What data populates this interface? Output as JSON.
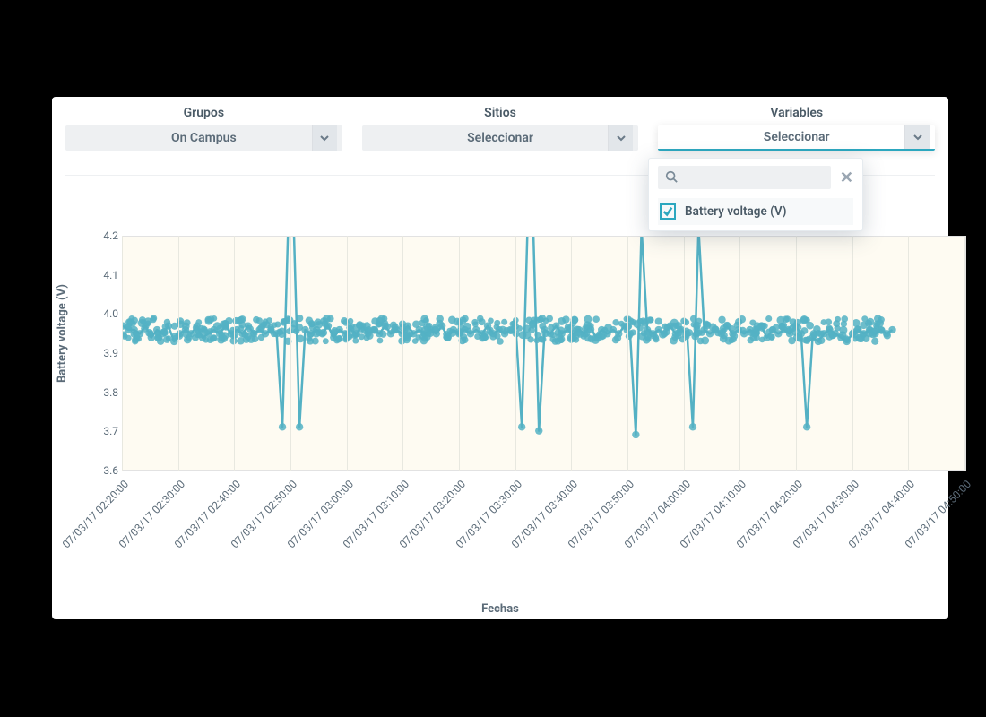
{
  "filters": {
    "grupos": {
      "label": "Grupos",
      "value": "On Campus"
    },
    "sitios": {
      "label": "Sitios",
      "value": "Seleccionar"
    },
    "variables": {
      "label": "Variables",
      "value": "Seleccionar"
    }
  },
  "variables_dropdown": {
    "search_placeholder": "",
    "close_title": "Cerrar",
    "items": [
      {
        "label": "Battery voltage (V)",
        "checked": true
      }
    ]
  },
  "colors": {
    "accent": "#2ca7bf",
    "series": "#54b1c4",
    "plot_bg": "#fefbf2"
  },
  "chart_data": {
    "type": "scatter",
    "title": "",
    "xlabel": "Fechas",
    "ylabel": "Battery voltage (V)",
    "ylim": [
      3.6,
      4.2
    ],
    "yticks": [
      3.6,
      3.7,
      3.8,
      3.9,
      4.0,
      4.1,
      4.2
    ],
    "x_tick_labels": [
      "07/03/17 02:20:00",
      "07/03/17 02:30:00",
      "07/03/17 02:40:00",
      "07/03/17 02:50:00",
      "07/03/17 03:00:00",
      "07/03/17 03:10:00",
      "07/03/17 03:20:00",
      "07/03/17 03:30:00",
      "07/03/17 03:40:00",
      "07/03/17 03:50:00",
      "07/03/17 04:00:00",
      "07/03/17 04:10:00",
      "07/03/17 04:20:00",
      "07/03/17 04:30:00",
      "07/03/17 04:40:00",
      "07/03/17 04:50:00"
    ],
    "series": [
      {
        "name": "Battery voltage (V)",
        "description": "Dense scatter, ~3.92–3.98 V baseline with several spikes above 4.2 V and dips to ~3.70 V. Approximate values sampled across the visible time range.",
        "x": [
          "07/03/17 02:20:00",
          "07/03/17 02:21:00",
          "07/03/17 02:22:00",
          "07/03/17 02:23:00",
          "07/03/17 02:24:00",
          "07/03/17 02:25:00",
          "07/03/17 02:26:00",
          "07/03/17 02:27:00",
          "07/03/17 02:28:00",
          "07/03/17 02:29:00",
          "07/03/17 02:30:00",
          "07/03/17 02:31:00",
          "07/03/17 02:32:00",
          "07/03/17 02:33:00",
          "07/03/17 02:34:00",
          "07/03/17 02:35:00",
          "07/03/17 02:36:00",
          "07/03/17 02:37:00",
          "07/03/17 02:38:00",
          "07/03/17 02:39:00",
          "07/03/17 02:40:00",
          "07/03/17 02:41:00",
          "07/03/17 02:42:00",
          "07/03/17 02:43:00",
          "07/03/17 02:44:00",
          "07/03/17 02:45:00",
          "07/03/17 02:46:00",
          "07/03/17 02:47:00",
          "07/03/17 02:48:00",
          "07/03/17 02:49:00",
          "07/03/17 02:50:00",
          "07/03/17 02:51:00",
          "07/03/17 02:52:00",
          "07/03/17 02:53:00",
          "07/03/17 02:54:00",
          "07/03/17 02:55:00",
          "07/03/17 02:56:00",
          "07/03/17 02:57:00",
          "07/03/17 02:58:00",
          "07/03/17 02:59:00",
          "07/03/17 03:00:00",
          "07/03/17 03:01:00",
          "07/03/17 03:02:00",
          "07/03/17 03:03:00",
          "07/03/17 03:04:00",
          "07/03/17 03:05:00",
          "07/03/17 03:06:00",
          "07/03/17 03:07:00",
          "07/03/17 03:08:00",
          "07/03/17 03:09:00",
          "07/03/17 03:10:00",
          "07/03/17 03:11:00",
          "07/03/17 03:12:00",
          "07/03/17 03:13:00",
          "07/03/17 03:14:00",
          "07/03/17 03:15:00",
          "07/03/17 03:16:00",
          "07/03/17 03:17:00",
          "07/03/17 03:18:00",
          "07/03/17 03:19:00",
          "07/03/17 03:20:00",
          "07/03/17 03:21:00",
          "07/03/17 03:22:00",
          "07/03/17 03:23:00",
          "07/03/17 03:24:00",
          "07/03/17 03:25:00",
          "07/03/17 03:26:00",
          "07/03/17 03:27:00",
          "07/03/17 03:28:00",
          "07/03/17 03:29:00",
          "07/03/17 03:30:00",
          "07/03/17 03:31:00",
          "07/03/17 03:32:00",
          "07/03/17 03:33:00",
          "07/03/17 03:34:00",
          "07/03/17 03:35:00",
          "07/03/17 03:36:00",
          "07/03/17 03:37:00",
          "07/03/17 03:38:00",
          "07/03/17 03:39:00",
          "07/03/17 03:40:00",
          "07/03/17 03:41:00",
          "07/03/17 03:42:00",
          "07/03/17 03:43:00",
          "07/03/17 03:44:00",
          "07/03/17 03:45:00",
          "07/03/17 03:46:00",
          "07/03/17 03:47:00",
          "07/03/17 03:48:00",
          "07/03/17 03:49:00",
          "07/03/17 03:50:00",
          "07/03/17 03:51:00",
          "07/03/17 03:52:00",
          "07/03/17 03:53:00",
          "07/03/17 03:54:00",
          "07/03/17 03:55:00",
          "07/03/17 03:56:00",
          "07/03/17 03:57:00",
          "07/03/17 03:58:00",
          "07/03/17 03:59:00",
          "07/03/17 04:00:00",
          "07/03/17 04:01:00",
          "07/03/17 04:02:00",
          "07/03/17 04:03:00",
          "07/03/17 04:04:00",
          "07/03/17 04:05:00",
          "07/03/17 04:06:00",
          "07/03/17 04:07:00",
          "07/03/17 04:08:00",
          "07/03/17 04:09:00",
          "07/03/17 04:10:00",
          "07/03/17 04:11:00",
          "07/03/17 04:12:00",
          "07/03/17 04:13:00",
          "07/03/17 04:14:00",
          "07/03/17 04:15:00",
          "07/03/17 04:16:00",
          "07/03/17 04:17:00",
          "07/03/17 04:18:00",
          "07/03/17 04:19:00",
          "07/03/17 04:20:00",
          "07/03/17 04:21:00",
          "07/03/17 04:22:00",
          "07/03/17 04:23:00",
          "07/03/17 04:24:00",
          "07/03/17 04:25:00",
          "07/03/17 04:26:00",
          "07/03/17 04:27:00",
          "07/03/17 04:28:00",
          "07/03/17 04:29:00",
          "07/03/17 04:30:00",
          "07/03/17 04:31:00",
          "07/03/17 04:32:00",
          "07/03/17 04:33:00",
          "07/03/17 04:34:00",
          "07/03/17 04:35:00"
        ],
        "values": [
          3.97,
          3.96,
          3.96,
          3.95,
          3.97,
          3.94,
          3.96,
          3.95,
          3.97,
          3.93,
          3.95,
          3.96,
          3.95,
          3.97,
          3.94,
          3.95,
          3.96,
          3.95,
          3.97,
          3.95,
          3.96,
          3.95,
          3.97,
          3.95,
          3.96,
          3.95,
          3.96,
          3.95,
          3.71,
          4.4,
          4.4,
          3.71,
          3.96,
          3.95,
          3.96,
          3.95,
          3.97,
          3.94,
          3.96,
          3.95,
          3.96,
          3.95,
          3.97,
          3.95,
          3.96,
          3.95,
          3.97,
          3.95,
          3.96,
          3.95,
          3.97,
          3.95,
          3.96,
          3.95,
          3.96,
          3.95,
          3.97,
          3.94,
          3.96,
          3.95,
          3.96,
          3.95,
          3.96,
          3.95,
          3.97,
          3.95,
          3.96,
          3.95,
          3.96,
          3.95,
          3.71,
          4.4,
          4.4,
          3.7,
          3.96,
          3.95,
          3.97,
          3.95,
          3.96,
          3.95,
          3.96,
          3.95,
          3.97,
          3.94,
          3.96,
          3.95,
          3.96,
          3.95,
          3.97,
          3.95,
          3.69,
          4.4,
          3.96,
          3.95,
          3.96,
          3.95,
          3.97,
          3.95,
          3.96,
          3.95,
          3.71,
          4.4,
          3.96,
          3.95,
          3.96,
          3.95,
          3.97,
          3.95,
          3.96,
          3.95,
          3.96,
          3.95,
          3.97,
          3.94,
          3.96,
          3.95,
          3.96,
          3.95,
          3.97,
          3.95,
          3.71,
          3.94,
          3.93,
          3.95,
          3.96,
          3.95,
          3.94,
          3.93,
          3.95,
          3.96,
          3.95,
          3.96,
          3.95,
          3.96,
          3.95,
          3.96
        ]
      }
    ]
  }
}
